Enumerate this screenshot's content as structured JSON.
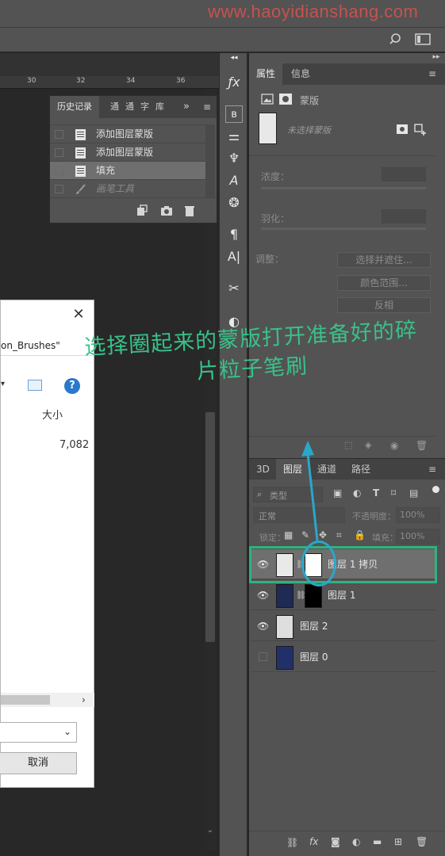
{
  "watermark": "www.haoyidianshang.com",
  "ruler": {
    "ticks": [
      "30",
      "32",
      "34",
      "36"
    ]
  },
  "history": {
    "tabs": [
      "历史记录",
      "通",
      "通",
      "字",
      "库"
    ],
    "rows": [
      {
        "label": "添加图层蒙版",
        "selected": false,
        "dim": false
      },
      {
        "label": "添加图层蒙版",
        "selected": false,
        "dim": false
      },
      {
        "label": "填充",
        "selected": true,
        "dim": false
      },
      {
        "label": "画笔工具",
        "selected": false,
        "dim": true
      }
    ]
  },
  "properties": {
    "tabs": [
      "属性",
      "信息"
    ],
    "mask_title": "蒙版",
    "selection_hint": "未选择蒙版",
    "density_label": "浓度：",
    "feather_label": "羽化：",
    "adjust_label": "调整：",
    "buttons": [
      "选择并遮住...",
      "颜色范围...",
      "反相"
    ]
  },
  "layers": {
    "tabs": [
      "3D",
      "图层",
      "通道",
      "路径"
    ],
    "filter_placeholder": "类型",
    "blend_mode": "正常",
    "opacity_label": "不透明度：",
    "opacity_value": "100%",
    "lock_label": "锁定：",
    "fill_label": "填充：",
    "fill_value": "100%",
    "rows": [
      {
        "name": "图层 1 拷贝",
        "visible": true,
        "selected": true
      },
      {
        "name": "图层 1",
        "visible": true,
        "selected": false
      },
      {
        "name": "图层 2",
        "visible": true,
        "selected": false
      },
      {
        "name": "图层 0",
        "visible": false,
        "selected": false
      }
    ]
  },
  "dialog": {
    "path_text": "on_Brushes\"",
    "column_header": "大小",
    "size_value": "7,082",
    "cancel_label": "取消"
  },
  "annotation": {
    "text": "选择圈起来的蒙版打开准备好的碎\n片粒子笔刷",
    "color": "#39c18a"
  },
  "icons": [
    "search-icon",
    "workspace-icon",
    "history-icon",
    "brush-icon",
    "camera-icon",
    "trash-icon",
    "eye-icon",
    "link-icon",
    "fx-icon"
  ]
}
